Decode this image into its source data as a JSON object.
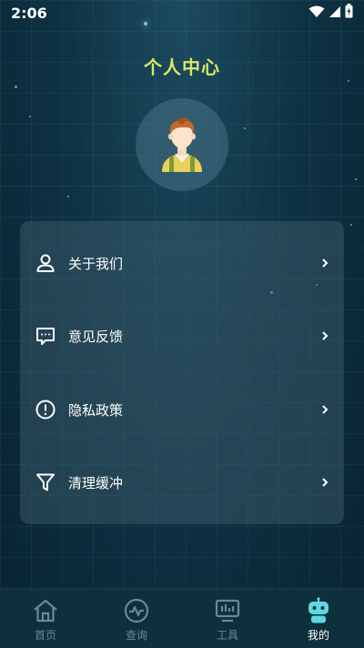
{
  "status_bar": {
    "time": "2:06",
    "icons": [
      "wifi-icon",
      "signal-icon",
      "battery-charging-icon"
    ]
  },
  "page": {
    "title": "个人中心"
  },
  "avatar": {
    "icon": "user-avatar-icon"
  },
  "menu": {
    "items": [
      {
        "label": "关于我们",
        "icon": "person-icon"
      },
      {
        "label": "意见反馈",
        "icon": "feedback-icon"
      },
      {
        "label": "隐私政策",
        "icon": "alert-circle-icon"
      },
      {
        "label": "清理缓冲",
        "icon": "filter-icon"
      }
    ]
  },
  "bottom_nav": {
    "active_index": 3,
    "items": [
      {
        "label": "首页",
        "icon": "home-icon"
      },
      {
        "label": "查询",
        "icon": "pulse-icon"
      },
      {
        "label": "工具",
        "icon": "monitor-icon"
      },
      {
        "label": "我的",
        "icon": "robot-icon"
      }
    ]
  },
  "colors": {
    "title": "#d7e86a",
    "accent": "#5ed8e0",
    "background": "#0f3344"
  }
}
